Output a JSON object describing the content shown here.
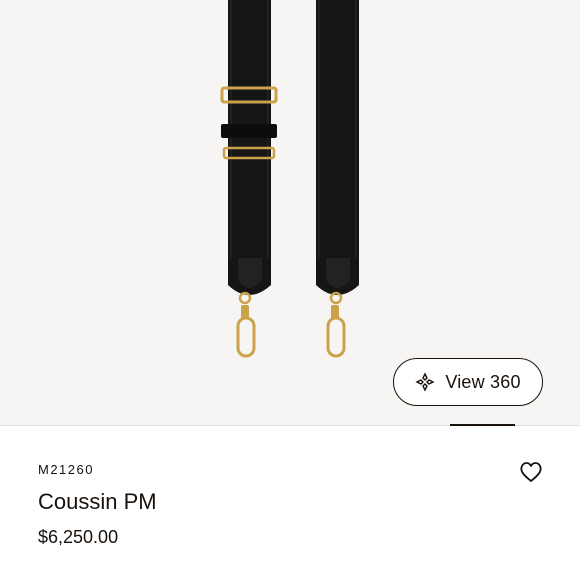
{
  "product_image": {
    "alt": "Coussin PM shoulder strap",
    "strap_color": "#141414",
    "hardware_color": "#c9a24a"
  },
  "view360": {
    "label": "View 360",
    "icon": "rotate-3d-icon"
  },
  "product": {
    "sku": "M21260",
    "name": "Coussin PM",
    "price": "$6,250.00"
  },
  "wishlist": {
    "icon": "heart-icon"
  },
  "colors": {
    "background": "#f6f5f3",
    "text": "#19110b",
    "divider": "#e1dfdc"
  }
}
